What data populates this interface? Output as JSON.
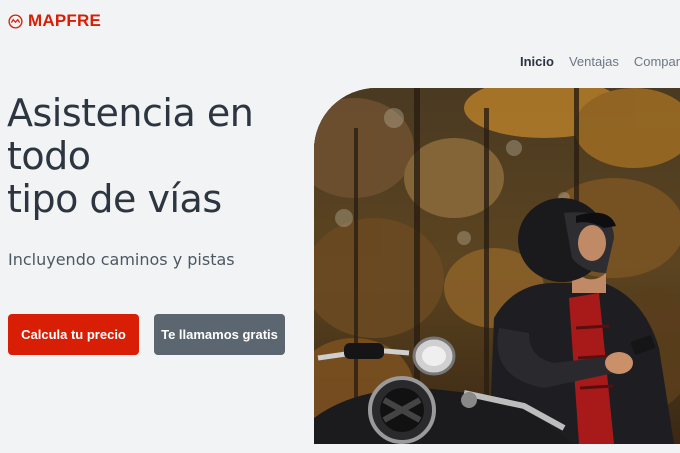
{
  "brand": {
    "name": "MAPFRE",
    "color": "#d81e05"
  },
  "nav": {
    "items": [
      {
        "label": "Inicio",
        "active": true
      },
      {
        "label": "Ventajas",
        "active": false
      },
      {
        "label": "Comparat",
        "active": false
      }
    ]
  },
  "hero": {
    "headline_lines": [
      "Asistencia en",
      "todo",
      "tipo de vías"
    ],
    "subtitle": "Incluyendo caminos y pistas",
    "image": "motorcyclist-in-forest"
  },
  "buttons": {
    "primary_label": "Calcula tu precio",
    "secondary_label": "Te llamamos gratis"
  },
  "colors": {
    "primary": "#d81e05",
    "secondary": "#5c6670",
    "background": "#f2f3f4",
    "text": "#2c3540"
  }
}
